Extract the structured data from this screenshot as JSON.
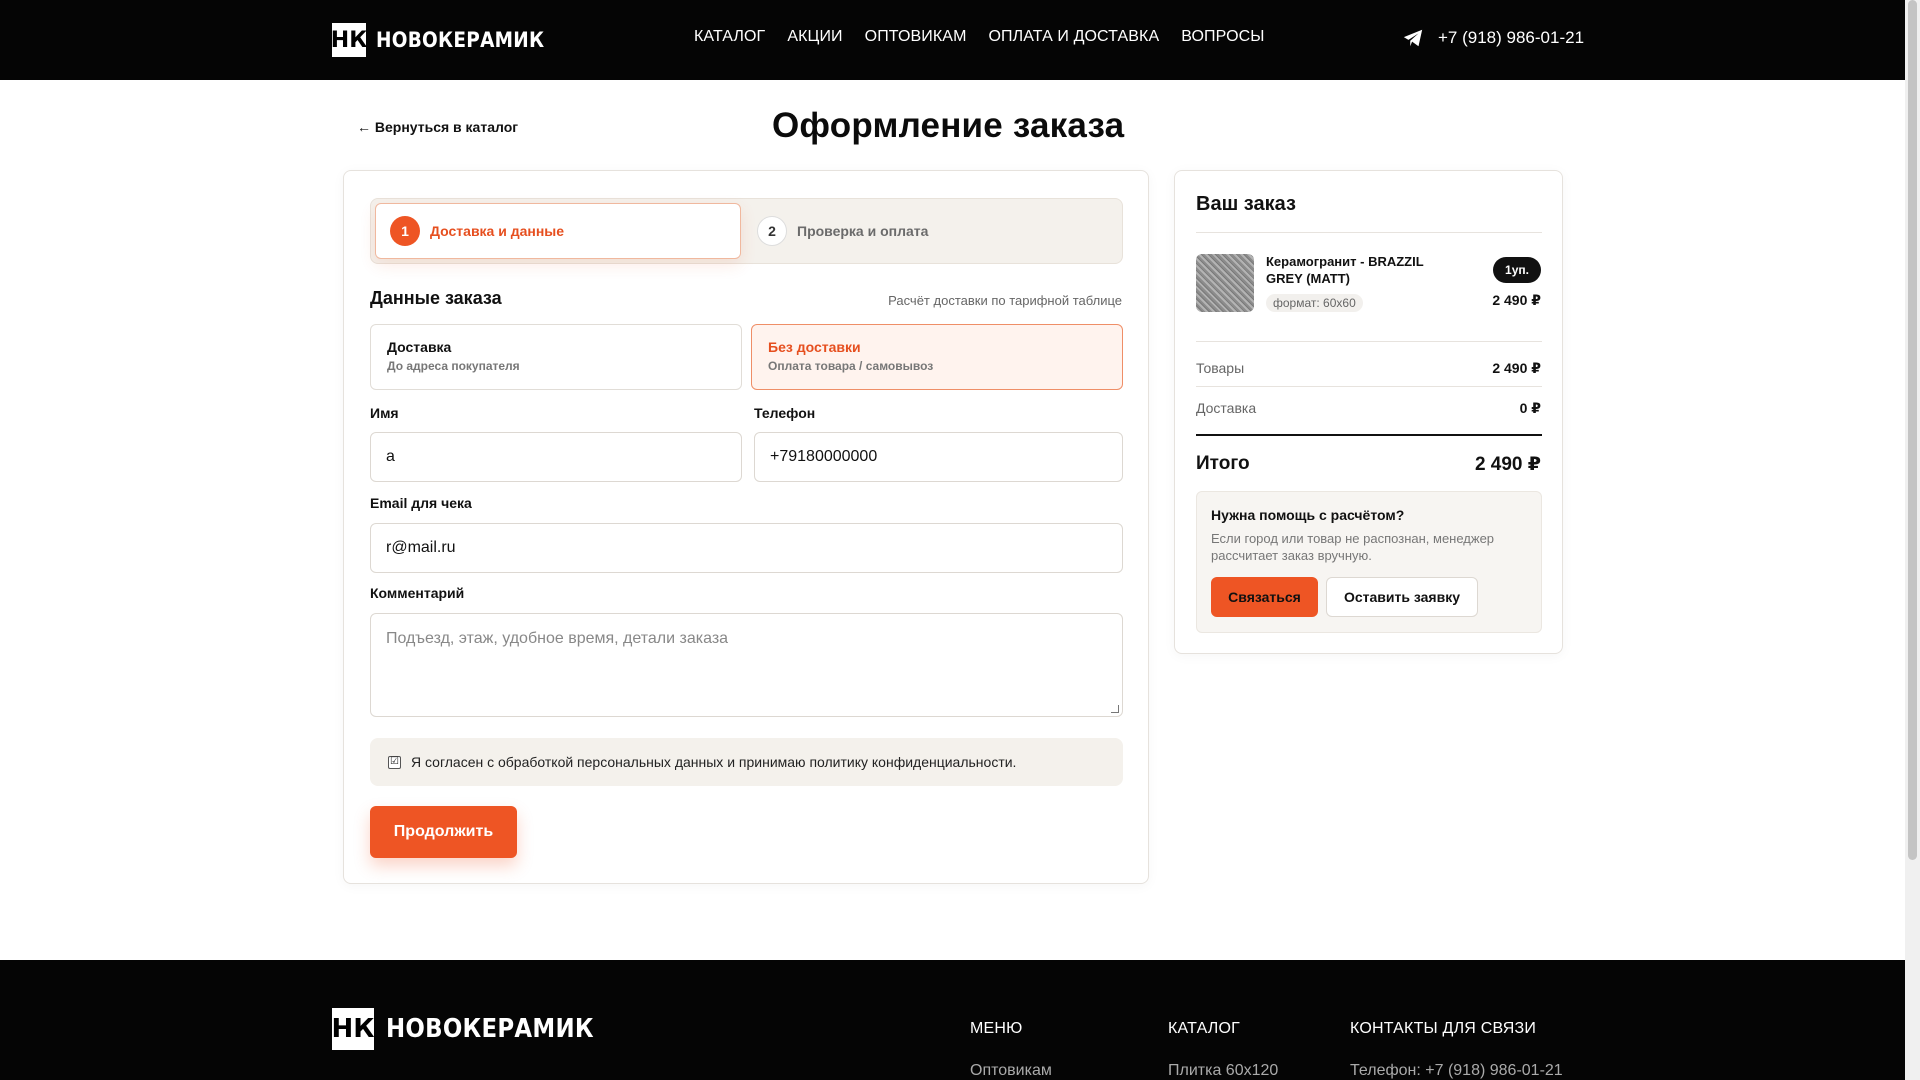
{
  "header": {
    "logo_mark": "НК",
    "logo_text": "НОВОКЕРАМИК",
    "nav": [
      "КАТАЛОГ",
      "АКЦИИ",
      "ОПТОВИКАМ",
      "ОПЛАТА И ДОСТАВКА",
      "ВОПРОСЫ"
    ],
    "phone": "+7 (918) 986-01-21",
    "icon": "telegram-icon"
  },
  "page": {
    "back_link": "← Вернуться в каталог",
    "title": "Оформление заказа"
  },
  "steps": [
    {
      "num": "1",
      "label": "Доставка и данные"
    },
    {
      "num": "2",
      "label": "Проверка и оплата"
    }
  ],
  "form": {
    "section_title": "Данные заказа",
    "section_note": "Расчёт доставки по тарифной таблице",
    "delivery_option": {
      "title": "Доставка",
      "subtitle": "До адреса покупателя"
    },
    "pickup_option": {
      "title": "Без доставки",
      "subtitle": "Оплата товара / самовывоз"
    },
    "name_label": "Имя",
    "name_value": "а",
    "phone_label": "Телефон",
    "phone_value": "+79180000000",
    "email_label": "Email для чека",
    "email_value": "r@mail.ru",
    "comment_label": "Комментарий",
    "comment_placeholder": "Подъезд, этаж, удобное время, детали заказа",
    "consent_check": "☑",
    "consent_text": "Я согласен с обработкой персональных данных и принимаю политику конфиденциальности.",
    "continue_button": "Продолжить"
  },
  "order": {
    "title": "Ваш заказ",
    "product_name": "Керамогранит - BRAZZIL GREY (MATT)",
    "product_format": "формат: 60х60",
    "qty": "1уп.",
    "price": "2 490 ₽",
    "goods_label": "Товары",
    "goods_value": "2 490 ₽",
    "delivery_label": "Доставка",
    "delivery_value": "0 ₽",
    "total_label": "Итого",
    "total_value": "2 490 ₽",
    "help_title": "Нужна помощь с расчётом?",
    "help_text": "Если город или товар не распознан, менеджер рассчитает заказ вручную.",
    "contact_button": "Связаться",
    "request_button": "Оставить заявку"
  },
  "footer": {
    "logo_mark": "НК",
    "logo_text": "НОВОКЕРАМИК",
    "menu_head": "МЕНЮ",
    "menu_first": "Оптовикам",
    "catalog_head": "КАТАЛОГ",
    "catalog_first": "Плитка 60х120",
    "contacts_head": "КОНТАКТЫ ДЛЯ СВЯЗИ",
    "contacts_first": "Телефон: +7 (918) 986-01-21"
  },
  "colors": {
    "accent": "#ee5524",
    "dark": "#050505"
  }
}
